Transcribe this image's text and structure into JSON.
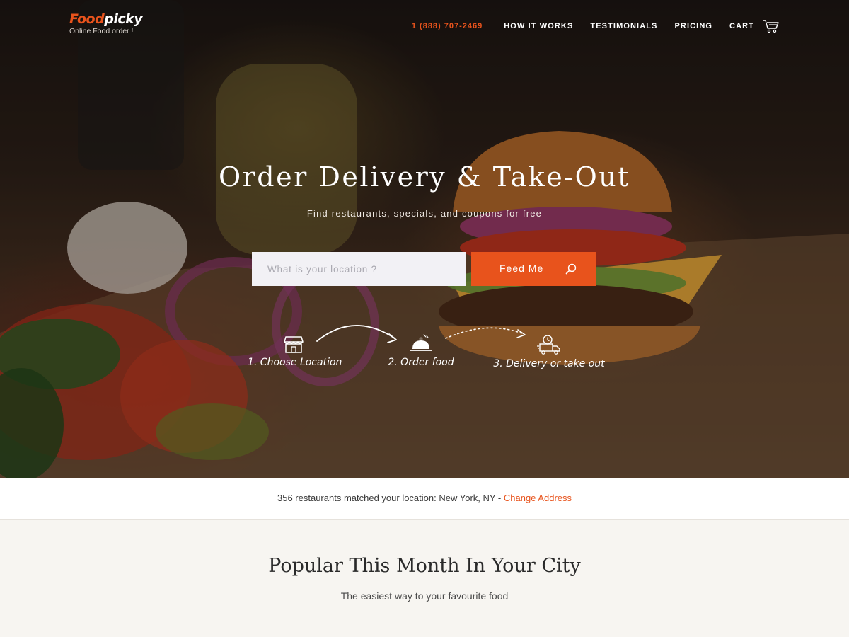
{
  "header": {
    "logo_primary": "Food",
    "logo_secondary": "picky",
    "logo_tagline": "Online Food order !",
    "phone": "1 (888) 707-2469",
    "nav": {
      "how_it_works": "HOW IT WORKS",
      "testimonials": "TESTIMONIALS",
      "pricing": "PRICING",
      "cart": "CART"
    }
  },
  "hero": {
    "title": "Order Delivery & Take-Out",
    "subtitle": "Find restaurants, specials, and coupons for free",
    "search_placeholder": "What is your location ?",
    "search_value": "",
    "button_label": "Feed Me",
    "steps": [
      {
        "label": "1. Choose Location",
        "icon": "store-icon"
      },
      {
        "label": "2. Order food",
        "icon": "cloche-icon"
      },
      {
        "label": "3. Delivery or take out",
        "icon": "delivery-truck-icon"
      }
    ]
  },
  "info_bar": {
    "text": "356 restaurants matched your location: New York, NY - ",
    "link": "Change Address"
  },
  "popular": {
    "title": "Popular This Month In Your City",
    "subtitle": "The easiest way to your favourite food"
  },
  "colors": {
    "accent": "#e8531c",
    "input_bg": "#f2f1f5",
    "page_bg": "#f7f5f1"
  }
}
